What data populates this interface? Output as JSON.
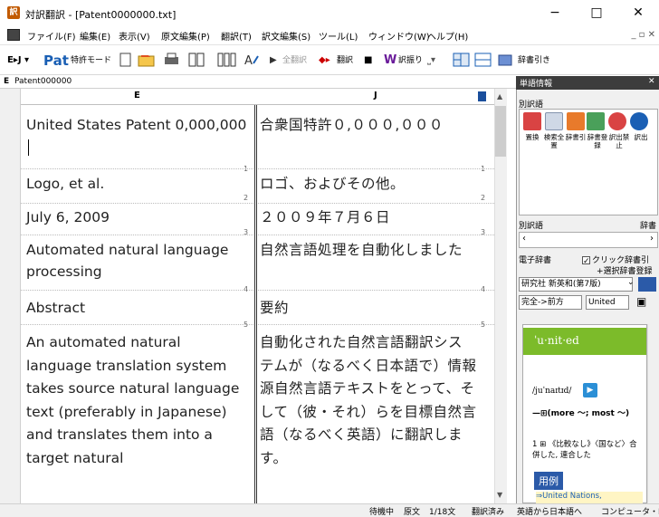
{
  "window": {
    "title": "対訳翻訳 - [Patent0000000.txt]",
    "app_icon_text": "訳",
    "minimize": "−",
    "maximize": "□",
    "close": "✕"
  },
  "menu": {
    "items": [
      "ファイル(F)",
      "編集(E)",
      "表示(V)",
      "原文編集(P)",
      "翻訳(T)",
      "訳文編集(S)",
      "ツール(L)",
      "ウィンドウ(W)",
      "ヘルプ(H)"
    ],
    "mdi_controls": "_ ▫ ✕"
  },
  "toolbar": {
    "direction": "E▸J ▾",
    "patent_logo": "Pat",
    "patent_mode": "特許モード",
    "translate_all": "全翻訳",
    "translate": "翻訳",
    "stop": "■",
    "assign": "訳振り",
    "dictionary_lookup": "辞書引き"
  },
  "document": {
    "tab_letter": "E",
    "tab_name": "Patent000000",
    "col_e": "E",
    "col_j": "J",
    "rows": [
      {
        "num": "1",
        "en": "United States Patent 0,000,000",
        "ja": "合衆国特許０,０００,０００"
      },
      {
        "num": "2",
        "en": "Logo, et al.",
        "ja": "ロゴ、およびその他。"
      },
      {
        "num": "3",
        "en": "July 6, 2009",
        "ja": "２００９年７月６日"
      },
      {
        "num": "4",
        "en": "Automated natural language processing",
        "ja": "自然言語処理を自動化しました"
      },
      {
        "num": "5",
        "en": "Abstract",
        "ja": "要約"
      },
      {
        "num": "6",
        "en": "An automated natural language translation system takes source natural language text (preferably in Japanese) and translates them into a target natural",
        "ja": "自動化された自然言語翻訳システムが（なるべく日本語で）情報源自然言語テキストをとって、そして（彼・それ）らを目標自然言語（なるべく英語）に翻訳します。"
      }
    ]
  },
  "status": {
    "state": "待機中",
    "mode": "原文",
    "sentence_pos": "1/18文",
    "translated": "翻訳済み",
    "direction": "英語から日本語へ",
    "engine": "コンピュータ・IT"
  },
  "side": {
    "header": "単語情報",
    "section_alt": "別訳語",
    "buttons": [
      "置換",
      "検索全置",
      "辞書引",
      "辞書登録",
      "訳出禁止",
      "訳出"
    ],
    "alt_list_label": "別訳語",
    "alt_list_col2": "辞書",
    "edict": "電子辞書",
    "click_lookup": "クリック辞書引",
    "add_dict": "+選択辞書登録",
    "dict_select": "研究社 新英和(第7版)",
    "match_mode": "完全->前方",
    "query": "United",
    "headword": "ˈu·nit·ed",
    "pron": "/juˈnaɪtɪd/",
    "def1": "—⊞(more 〜; most 〜)",
    "def2": "1 ⊞ 《比較なし》〈国など〉合併した, 連合した",
    "example_tag": "用例",
    "example_link": "⇒United Nations,"
  }
}
